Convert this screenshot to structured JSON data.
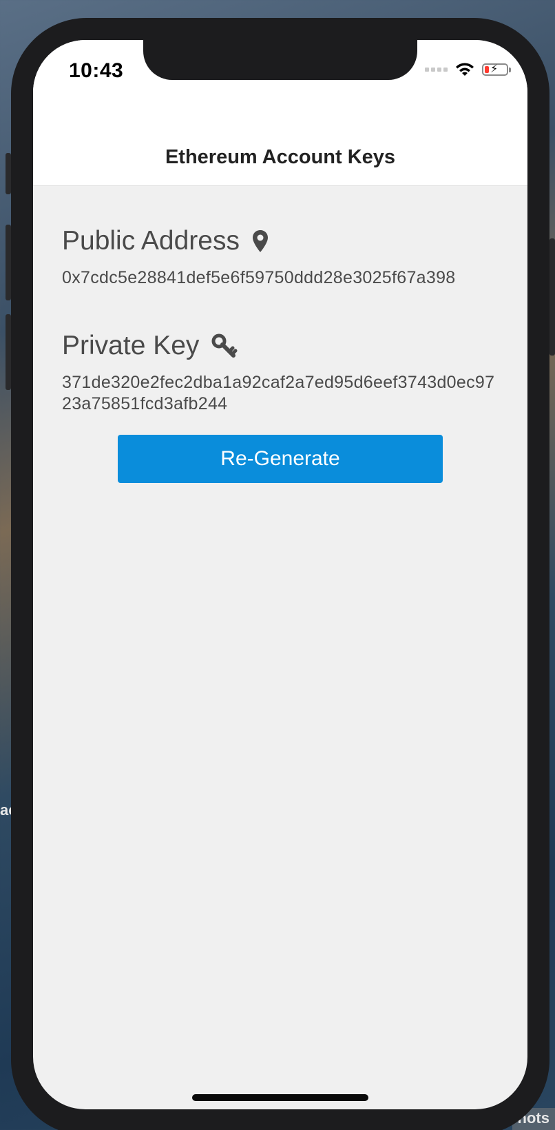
{
  "desktop": {
    "edge_text": "ac",
    "corner_text": "nots"
  },
  "status_bar": {
    "time": "10:43",
    "icons": [
      "signal-dots-icon",
      "wifi-icon",
      "battery-charging-icon"
    ],
    "battery_level_color": "#ff3b30"
  },
  "nav": {
    "title": "Ethereum Account Keys"
  },
  "public_address": {
    "label": "Public Address",
    "icon": "map-marker-icon",
    "value": "0x7cdc5e28841def5e6f59750ddd28e3025f67a398"
  },
  "private_key": {
    "label": "Private Key",
    "icon": "key-icon",
    "value": "371de320e2fec2dba1a92caf2a7ed95d6eef3743d0ec9723a75851fcd3afb244"
  },
  "actions": {
    "regenerate_label": "Re-Generate",
    "button_color": "#0a8ddb"
  }
}
